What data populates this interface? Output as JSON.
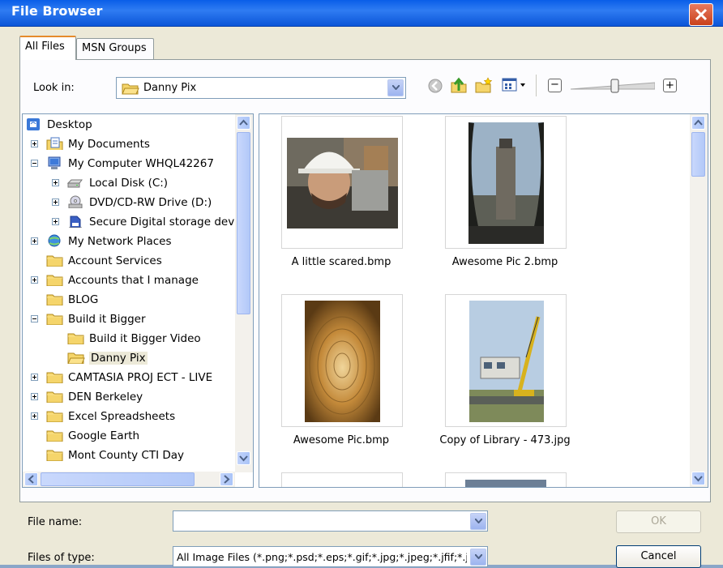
{
  "window": {
    "title": "File Browser"
  },
  "tabs": [
    {
      "label": "All Files",
      "active": true
    },
    {
      "label": "MSN Groups",
      "active": false
    }
  ],
  "look_in": {
    "label": "Look in:",
    "value": "Danny Pix"
  },
  "toolbar": {
    "zoom_minus": "−",
    "zoom_plus": "+",
    "zoom_level": 0.82
  },
  "tree": [
    {
      "label": "Desktop",
      "icon": "desktop-icon",
      "indent": 0,
      "expander": "none"
    },
    {
      "label": "My Documents",
      "icon": "documents-icon",
      "indent": 1,
      "expander": "plus"
    },
    {
      "label": "My Computer WHQL42267",
      "icon": "computer-icon",
      "indent": 1,
      "expander": "minus"
    },
    {
      "label": "Local Disk (C:)",
      "icon": "disk-icon",
      "indent": 2,
      "expander": "plus"
    },
    {
      "label": "DVD/CD-RW Drive (D:)",
      "icon": "dvd-icon",
      "indent": 2,
      "expander": "plus"
    },
    {
      "label": "Secure Digital storage devi",
      "icon": "sd-card-icon",
      "indent": 2,
      "expander": "plus"
    },
    {
      "label": "My Network Places",
      "icon": "network-icon",
      "indent": 1,
      "expander": "plus"
    },
    {
      "label": "Account Services",
      "icon": "folder-icon",
      "indent": 1,
      "expander": "none"
    },
    {
      "label": "Accounts that I manage",
      "icon": "folder-icon",
      "indent": 1,
      "expander": "plus"
    },
    {
      "label": "BLOG",
      "icon": "folder-icon",
      "indent": 1,
      "expander": "none"
    },
    {
      "label": "Build it Bigger",
      "icon": "folder-icon",
      "indent": 1,
      "expander": "minus"
    },
    {
      "label": "Build it Bigger Video",
      "icon": "folder-icon",
      "indent": 2,
      "expander": "none"
    },
    {
      "label": "Danny Pix",
      "icon": "folder-open-icon",
      "indent": 2,
      "expander": "none",
      "selected": true
    },
    {
      "label": "CAMTASIA PROJ ECT - LIVE",
      "icon": "folder-icon",
      "indent": 1,
      "expander": "plus"
    },
    {
      "label": "DEN Berkeley",
      "icon": "folder-icon",
      "indent": 1,
      "expander": "plus"
    },
    {
      "label": "Excel Spreadsheets",
      "icon": "folder-icon",
      "indent": 1,
      "expander": "plus"
    },
    {
      "label": "Google Earth",
      "icon": "folder-icon",
      "indent": 1,
      "expander": "none"
    },
    {
      "label": "Mont County CTI Day",
      "icon": "folder-icon",
      "indent": 1,
      "expander": "none"
    }
  ],
  "files": [
    {
      "name": "A little scared.bmp"
    },
    {
      "name": "Awesome Pic 2.bmp"
    },
    {
      "name": "Awesome Pic.bmp"
    },
    {
      "name": "Copy of Library - 473.jpg"
    }
  ],
  "filename": {
    "label": "File name:",
    "value": ""
  },
  "filetype": {
    "label": "Files of type:",
    "value": "All Image Files (*.png;*.psd;*.eps;*.gif;*.jpg;*.jpeg;*.jfif;*.j"
  },
  "buttons": {
    "ok": "OK",
    "cancel": "Cancel"
  }
}
